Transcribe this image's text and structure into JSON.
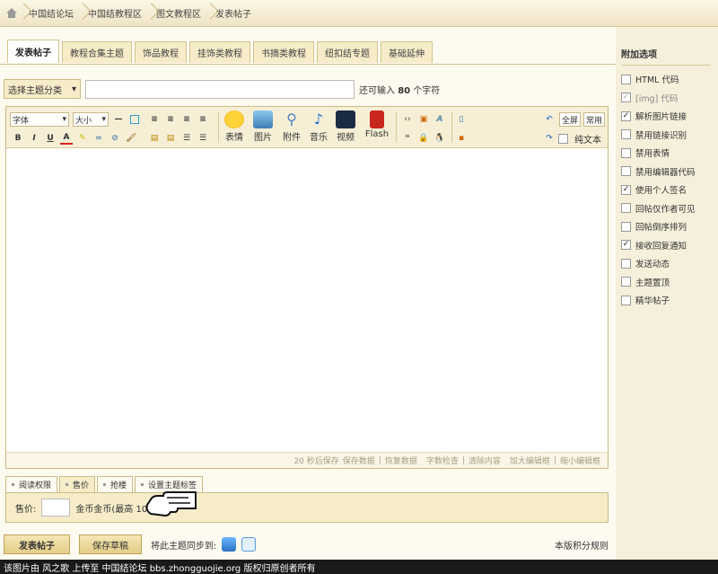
{
  "breadcrumb": [
    "中国结论坛",
    "中国结教程区",
    "图文教程区",
    "发表帖子"
  ],
  "tabs": [
    {
      "label": "发表帖子",
      "active": true
    },
    {
      "label": "教程合集主题",
      "active": false
    },
    {
      "label": "饰品教程",
      "active": false
    },
    {
      "label": "挂饰类教程",
      "active": false
    },
    {
      "label": "书摘类教程",
      "active": false
    },
    {
      "label": "纽扣结专题",
      "active": false
    },
    {
      "label": "基础延伸",
      "active": false
    }
  ],
  "subject": {
    "category": "选择主题分类",
    "hint_prefix": "还可输入",
    "hint_count": "80",
    "hint_suffix": "个字符"
  },
  "toolbar": {
    "font": "字体",
    "size": "大小",
    "bold": "B",
    "italic": "I",
    "underline": "U",
    "fontcolor": "A",
    "emoji": "表情",
    "image": "图片",
    "attach": "附件",
    "music": "音乐",
    "video": "视频",
    "flash": "Flash",
    "fullscreen": "全屏",
    "common": "常用",
    "plaintext": "纯文本"
  },
  "status": [
    "20 秒后保存",
    "保存数据",
    "|",
    "恢复数据",
    "字数检查",
    "|",
    "清除内容",
    "加大编辑框",
    "|",
    "缩小编辑框"
  ],
  "extra_tabs": [
    {
      "label": "阅读权限",
      "active": false
    },
    {
      "label": "售价",
      "active": true
    },
    {
      "label": "抢楼",
      "active": false
    },
    {
      "label": "设置主题标签",
      "active": false
    }
  ],
  "price": {
    "label": "售价:",
    "unit": "金币金币(最高 100 金币)"
  },
  "bottom": {
    "submit": "发表帖子",
    "draft": "保存草稿",
    "sync": "将此主题同步到:",
    "rules": "本版积分规则"
  },
  "sidebar": {
    "title": "附加选项",
    "options": [
      {
        "label": "HTML 代码",
        "checked": false
      },
      {
        "label": "[img] 代码",
        "checked": true,
        "disabled": true
      },
      {
        "label": "解析图片链接",
        "checked": true
      },
      {
        "label": "禁用链接识别",
        "checked": false
      },
      {
        "label": "禁用表情",
        "checked": false
      },
      {
        "label": "禁用编辑器代码",
        "checked": false
      },
      {
        "label": "使用个人签名",
        "checked": true
      },
      {
        "label": "回帖仅作者可见",
        "checked": false
      },
      {
        "label": "回帖倒序排列",
        "checked": false
      },
      {
        "label": "接收回复通知",
        "checked": true
      },
      {
        "label": "发送动态",
        "checked": false
      },
      {
        "label": "主题置顶",
        "checked": false
      },
      {
        "label": "精华帖子",
        "checked": false
      }
    ]
  },
  "footer": "该图片由 风之歌 上传至 中国结论坛 bbs.zhongguojie.org 版权归原创者所有"
}
